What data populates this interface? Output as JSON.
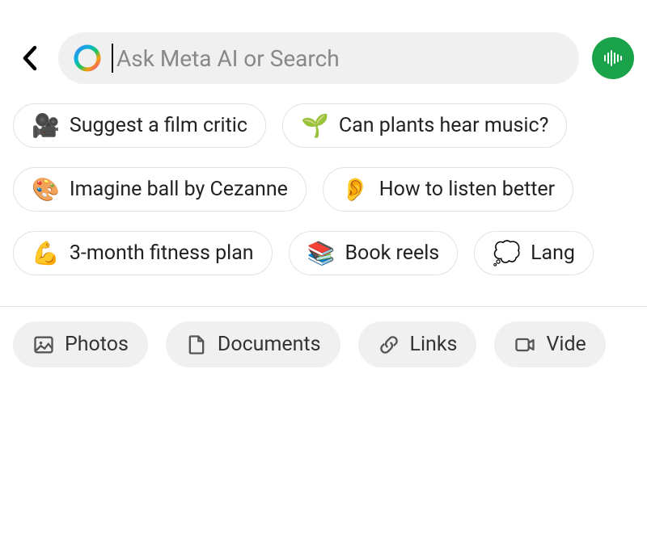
{
  "header": {
    "search_placeholder": "Ask Meta AI or Search"
  },
  "suggestions": {
    "rows": [
      [
        {
          "emoji": "🎥",
          "label": "Suggest a film critic"
        },
        {
          "emoji": "🌱",
          "label": "Can plants hear music?"
        }
      ],
      [
        {
          "emoji": "🎨",
          "label": "Imagine ball by Cezanne"
        },
        {
          "emoji": "👂",
          "label": "How to listen better"
        }
      ],
      [
        {
          "emoji": "💪",
          "label": "3-month fitness plan"
        },
        {
          "emoji": "📚",
          "label": "Book reels"
        },
        {
          "emoji": "💭",
          "label": "Lang"
        }
      ]
    ]
  },
  "filters": [
    {
      "icon": "photo",
      "label": "Photos"
    },
    {
      "icon": "document",
      "label": "Documents"
    },
    {
      "icon": "link",
      "label": "Links"
    },
    {
      "icon": "video",
      "label": "Vide"
    }
  ]
}
